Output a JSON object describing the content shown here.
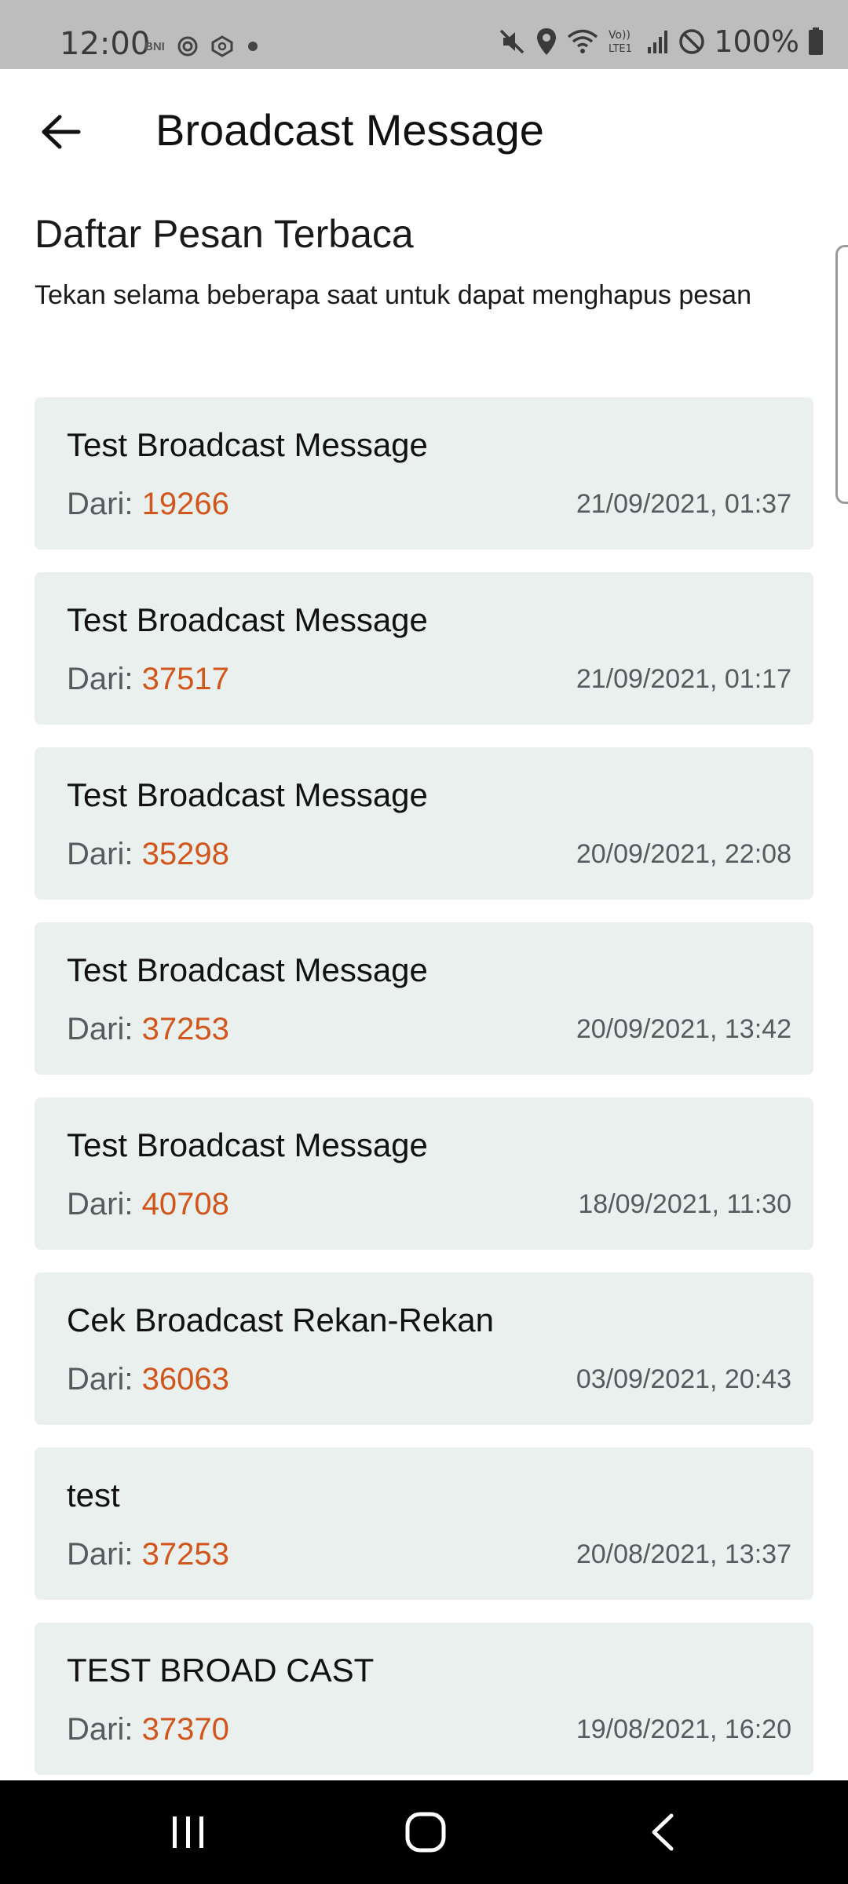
{
  "status_bar": {
    "time": "12:00",
    "carrier_badge": "BNI",
    "battery": "100%"
  },
  "app_bar": {
    "title": "Broadcast Message",
    "back_icon": "arrow-left-icon"
  },
  "section": {
    "title": "Daftar Pesan Terbaca",
    "subtitle": "Tekan selama beberapa saat untuk dapat menghapus pesan"
  },
  "messages": [
    {
      "title": "Test Broadcast Message",
      "from_label": "Dari: ",
      "from_id": "19266",
      "date": "21/09/2021, 01:37"
    },
    {
      "title": "Test Broadcast Message",
      "from_label": "Dari: ",
      "from_id": "37517",
      "date": "21/09/2021, 01:17"
    },
    {
      "title": "Test Broadcast Message",
      "from_label": "Dari: ",
      "from_id": "35298",
      "date": "20/09/2021, 22:08"
    },
    {
      "title": "Test Broadcast Message",
      "from_label": "Dari: ",
      "from_id": "37253",
      "date": "20/09/2021, 13:42"
    },
    {
      "title": "Test Broadcast Message",
      "from_label": "Dari: ",
      "from_id": "40708",
      "date": "18/09/2021, 11:30"
    },
    {
      "title": "Cek Broadcast Rekan-Rekan",
      "from_label": "Dari: ",
      "from_id": "36063",
      "date": "03/09/2021, 20:43"
    },
    {
      "title": "test",
      "from_label": "Dari: ",
      "from_id": "37253",
      "date": "20/08/2021, 13:37"
    },
    {
      "title": "TEST BROAD CAST",
      "from_label": "Dari: ",
      "from_id": "37370",
      "date": "19/08/2021, 16:20"
    }
  ],
  "colors": {
    "card_background": "#e9f0ee",
    "accent_id": "#d2561b",
    "status_bar": "#bdbdbd",
    "nav_bar": "#000000"
  },
  "nav_bar": {
    "recent_icon": "recent-apps-icon",
    "home_icon": "home-icon",
    "back_icon": "back-chevron-icon"
  }
}
